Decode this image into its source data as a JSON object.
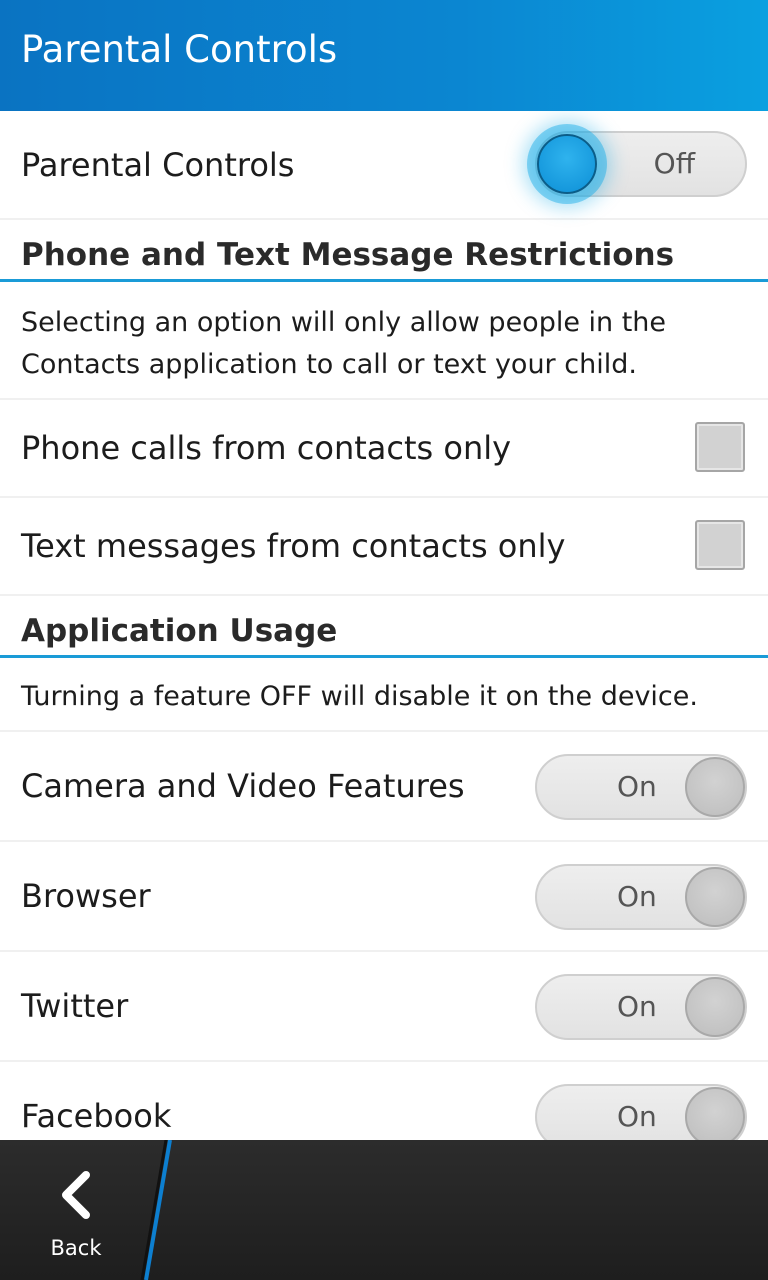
{
  "header": {
    "title": "Parental Controls"
  },
  "parental_controls": {
    "label": "Parental Controls",
    "toggle_text": "Off",
    "state": "off"
  },
  "section_phone": {
    "title": "Phone and Text Message Restrictions",
    "description": "Selecting an option will only allow people in the Contacts application to call or text your child.",
    "options": [
      {
        "label": "Phone calls from contacts only",
        "checked": false
      },
      {
        "label": "Text messages from contacts only",
        "checked": false
      }
    ]
  },
  "section_apps": {
    "title": "Application Usage",
    "description": "Turning a feature OFF will disable it on the device.",
    "items": [
      {
        "label": "Camera and Video Features",
        "toggle_text": "On",
        "state": "on"
      },
      {
        "label": "Browser",
        "toggle_text": "On",
        "state": "on"
      },
      {
        "label": "Twitter",
        "toggle_text": "On",
        "state": "on"
      },
      {
        "label": "Facebook",
        "toggle_text": "On",
        "state": "on"
      }
    ]
  },
  "bottom_bar": {
    "back_label": "Back"
  },
  "colors": {
    "accent": "#1a9bd7",
    "title_bar": "#0b86d1",
    "bottom_bar": "#262626"
  },
  "icons": {
    "back": "chevron-left-icon"
  }
}
